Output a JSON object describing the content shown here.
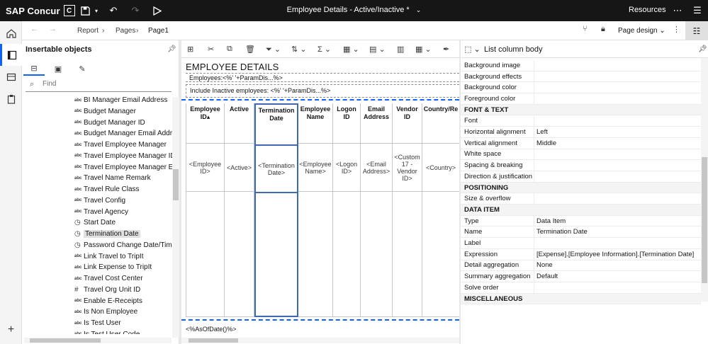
{
  "topbar": {
    "brand": "SAP Concur",
    "brand_mark": "C",
    "title": "Employee Details - Active/Inactive *",
    "resources": "Resources",
    "icons": [
      "save-icon",
      "undo-icon",
      "redo-icon",
      "run-icon",
      "more-icon",
      "menu-icon"
    ]
  },
  "rail": {
    "items": [
      "home-icon",
      "page-icon",
      "data-module-icon",
      "clipboard-icon",
      "add-icon"
    ],
    "active_index": 1
  },
  "subbar": {
    "breadcrumbs": [
      "Report",
      "Pages",
      "Page1"
    ],
    "page_design": "Page design"
  },
  "insertable": {
    "title": "Insertable objects",
    "search_placeholder": "Find",
    "items": [
      {
        "icon": "abc",
        "label": "BI Manager Email Address"
      },
      {
        "icon": "abc",
        "label": "Budget Manager"
      },
      {
        "icon": "abc",
        "label": "Budget Manager ID"
      },
      {
        "icon": "abc",
        "label": "Budget Manager Email Address"
      },
      {
        "icon": "abc",
        "label": "Travel Employee Manager"
      },
      {
        "icon": "abc",
        "label": "Travel Employee Manager ID"
      },
      {
        "icon": "abc",
        "label": "Travel Employee Manager Email"
      },
      {
        "icon": "abc",
        "label": "Travel Name Remark"
      },
      {
        "icon": "abc",
        "label": "Travel Rule Class"
      },
      {
        "icon": "abc",
        "label": "Travel Config"
      },
      {
        "icon": "abc",
        "label": "Travel Agency"
      },
      {
        "icon": "clock",
        "label": "Start Date"
      },
      {
        "icon": "clock",
        "label": "Termination Date"
      },
      {
        "icon": "clock",
        "label": "Password Change Date/Time"
      },
      {
        "icon": "abc",
        "label": "Link Travel to TripIt"
      },
      {
        "icon": "abc",
        "label": "Link Expense to TripIt"
      },
      {
        "icon": "abc",
        "label": "Travel Cost Center"
      },
      {
        "icon": "hash",
        "label": "Travel Org Unit ID"
      },
      {
        "icon": "abc",
        "label": "Enable E-Receipts"
      },
      {
        "icon": "abc",
        "label": "Is Non Employee"
      },
      {
        "icon": "abc",
        "label": "Is Test User"
      },
      {
        "icon": "abc",
        "label": "Is Test User Code"
      }
    ],
    "selected_index": 12
  },
  "report": {
    "title": "EMPLOYEE DETAILS",
    "line1": "Employees:<%' '+ParamDis...%>",
    "line2": "Include Inactive employees:  <%' '+ParamDis...%>",
    "footer": "<%AsOfDate()%>",
    "columns": [
      {
        "header": "Employee ID",
        "sort": "▴",
        "body": "<Employee ID>"
      },
      {
        "header": "Active",
        "body": "<Active>"
      },
      {
        "header": "Termination Date",
        "body": "<Termination Date>"
      },
      {
        "header": "Employee Name",
        "body": "<Employee Name>"
      },
      {
        "header": "Logon ID",
        "body": "<Logon ID>"
      },
      {
        "header": "Email Address",
        "body": "<Email Address>"
      },
      {
        "header": "Vendor ID",
        "body": "<Custom 17 - Vendor ID>"
      },
      {
        "header": "Country/Re",
        "body": "<Country>"
      }
    ],
    "selected_column": 2
  },
  "properties": {
    "title": "List column body",
    "rows": [
      {
        "k": "Background image",
        "v": ""
      },
      {
        "k": "Background effects",
        "v": ""
      },
      {
        "k": "Background color",
        "v": ""
      },
      {
        "k": "Foreground color",
        "v": ""
      },
      {
        "section": "FONT & TEXT"
      },
      {
        "k": "Font",
        "v": ""
      },
      {
        "k": "Horizontal alignment",
        "v": "Left"
      },
      {
        "k": "Vertical alignment",
        "v": "Middle"
      },
      {
        "k": "White space",
        "v": ""
      },
      {
        "k": "Spacing & breaking",
        "v": ""
      },
      {
        "k": "Direction & justification",
        "v": ""
      },
      {
        "section": "POSITIONING"
      },
      {
        "k": "Size & overflow",
        "v": ""
      },
      {
        "section": "DATA ITEM"
      },
      {
        "k": "Type",
        "v": "Data Item"
      },
      {
        "k": "Name",
        "v": " Termination Date"
      },
      {
        "k": "Label",
        "v": ""
      },
      {
        "k": "Expression",
        "v": "[Expense].[Employee Information].[Termination Date]"
      },
      {
        "k": "Detail aggregation",
        "v": "None"
      },
      {
        "k": "Summary aggregation",
        "v": "Default"
      },
      {
        "k": "Solve order",
        "v": ""
      },
      {
        "section": "MISCELLANEOUS"
      }
    ]
  },
  "colors": {
    "topbar_bg": "#161616",
    "accent": "#0f62fe",
    "selection": "#3d6ab3"
  }
}
